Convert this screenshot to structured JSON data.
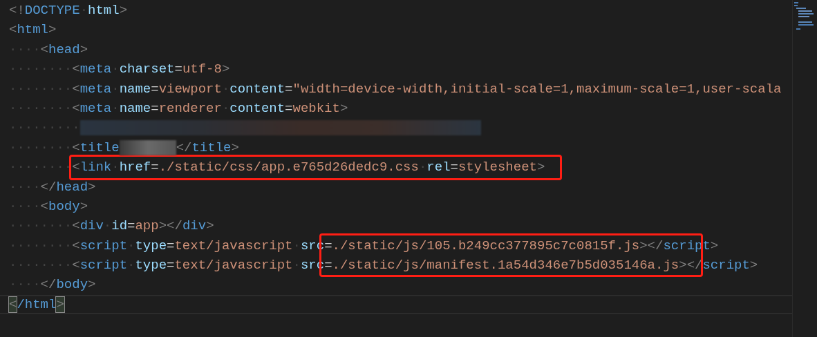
{
  "editor": {
    "lines": [
      {
        "current": false,
        "tokens": [
          {
            "kind": "punct",
            "text": "<!"
          },
          {
            "kind": "tag",
            "text": "DOCTYPE"
          },
          {
            "kind": "ws",
            "text": "·"
          },
          {
            "kind": "attr",
            "text": "html"
          },
          {
            "kind": "punct",
            "text": ">"
          }
        ]
      },
      {
        "current": false,
        "tokens": [
          {
            "kind": "punct",
            "text": "<"
          },
          {
            "kind": "tag",
            "text": "html"
          },
          {
            "kind": "punct",
            "text": ">"
          }
        ]
      },
      {
        "current": false,
        "tokens": [
          {
            "kind": "ws",
            "text": "····"
          },
          {
            "kind": "punct",
            "text": "<"
          },
          {
            "kind": "tag",
            "text": "head"
          },
          {
            "kind": "punct",
            "text": ">"
          }
        ]
      },
      {
        "current": false,
        "tokens": [
          {
            "kind": "ws",
            "text": "········"
          },
          {
            "kind": "punct",
            "text": "<"
          },
          {
            "kind": "tag",
            "text": "meta"
          },
          {
            "kind": "ws",
            "text": "·"
          },
          {
            "kind": "attr",
            "text": "charset"
          },
          {
            "kind": "eq",
            "text": "="
          },
          {
            "kind": "value",
            "text": "utf-8"
          },
          {
            "kind": "punct",
            "text": ">"
          }
        ]
      },
      {
        "current": false,
        "tokens": [
          {
            "kind": "ws",
            "text": "········"
          },
          {
            "kind": "punct",
            "text": "<"
          },
          {
            "kind": "tag",
            "text": "meta"
          },
          {
            "kind": "ws",
            "text": "·"
          },
          {
            "kind": "attr",
            "text": "name"
          },
          {
            "kind": "eq",
            "text": "="
          },
          {
            "kind": "value",
            "text": "viewport"
          },
          {
            "kind": "ws",
            "text": "·"
          },
          {
            "kind": "attr",
            "text": "content"
          },
          {
            "kind": "eq",
            "text": "="
          },
          {
            "kind": "value",
            "text": "\"width=device-width,initial-scale=1,maximum-scale=1,user-scala"
          }
        ]
      },
      {
        "current": false,
        "tokens": [
          {
            "kind": "ws",
            "text": "········"
          },
          {
            "kind": "punct",
            "text": "<"
          },
          {
            "kind": "tag",
            "text": "meta"
          },
          {
            "kind": "ws",
            "text": "·"
          },
          {
            "kind": "attr",
            "text": "name"
          },
          {
            "kind": "eq",
            "text": "="
          },
          {
            "kind": "value",
            "text": "renderer"
          },
          {
            "kind": "ws",
            "text": "·"
          },
          {
            "kind": "attr",
            "text": "content"
          },
          {
            "kind": "eq",
            "text": "="
          },
          {
            "kind": "value",
            "text": "webkit"
          },
          {
            "kind": "punct",
            "text": ">"
          }
        ]
      },
      {
        "current": false,
        "tokens": [
          {
            "kind": "ws",
            "text": "·········"
          },
          {
            "kind": "blur"
          }
        ]
      },
      {
        "current": false,
        "tokens": [
          {
            "kind": "ws",
            "text": "········"
          },
          {
            "kind": "punct",
            "text": "<"
          },
          {
            "kind": "tag",
            "text": "title"
          },
          {
            "kind": "blur-short"
          },
          {
            "kind": "punct",
            "text": "</"
          },
          {
            "kind": "tag",
            "text": "title"
          },
          {
            "kind": "punct",
            "text": ">"
          }
        ]
      },
      {
        "current": false,
        "tokens": [
          {
            "kind": "ws",
            "text": "········"
          },
          {
            "kind": "box",
            "tokens": [
              {
                "kind": "punct",
                "text": "<"
              },
              {
                "kind": "tag",
                "text": "link"
              },
              {
                "kind": "ws",
                "text": "·"
              },
              {
                "kind": "attr",
                "text": "href"
              },
              {
                "kind": "eq",
                "text": "="
              },
              {
                "kind": "value",
                "text": "./static/css/app.e765d26dedc9.css"
              },
              {
                "kind": "ws",
                "text": "·"
              },
              {
                "kind": "attr",
                "text": "rel"
              },
              {
                "kind": "eq",
                "text": "="
              },
              {
                "kind": "value",
                "text": "stylesheet"
              },
              {
                "kind": "punct",
                "text": ">"
              }
            ]
          }
        ]
      },
      {
        "current": false,
        "tokens": [
          {
            "kind": "ws",
            "text": "····"
          },
          {
            "kind": "punct",
            "text": "</"
          },
          {
            "kind": "tag",
            "text": "head"
          },
          {
            "kind": "punct",
            "text": ">"
          }
        ]
      },
      {
        "current": false,
        "tokens": [
          {
            "kind": "ws",
            "text": "····"
          },
          {
            "kind": "punct",
            "text": "<"
          },
          {
            "kind": "tag",
            "text": "body"
          },
          {
            "kind": "punct",
            "text": ">"
          }
        ]
      },
      {
        "current": false,
        "tokens": [
          {
            "kind": "ws",
            "text": "········"
          },
          {
            "kind": "punct",
            "text": "<"
          },
          {
            "kind": "tag",
            "text": "div"
          },
          {
            "kind": "ws",
            "text": "·"
          },
          {
            "kind": "attr",
            "text": "id"
          },
          {
            "kind": "eq",
            "text": "="
          },
          {
            "kind": "value",
            "text": "app"
          },
          {
            "kind": "punct",
            "text": "></"
          },
          {
            "kind": "tag",
            "text": "div"
          },
          {
            "kind": "punct",
            "text": ">"
          }
        ]
      },
      {
        "current": false,
        "tokens": [
          {
            "kind": "ws",
            "text": "········"
          },
          {
            "kind": "punct",
            "text": "<"
          },
          {
            "kind": "tag",
            "text": "script"
          },
          {
            "kind": "ws",
            "text": "·"
          },
          {
            "kind": "attr",
            "text": "type"
          },
          {
            "kind": "eq",
            "text": "="
          },
          {
            "kind": "value",
            "text": "text/javascript"
          },
          {
            "kind": "ws",
            "text": "·"
          },
          {
            "kind": "attr",
            "text": "src"
          },
          {
            "kind": "box",
            "tokens": [
              {
                "kind": "eq",
                "text": "="
              },
              {
                "kind": "value",
                "text": "./static/js/105.b249cc377895c7c0815f.js"
              }
            ]
          },
          {
            "kind": "punct",
            "text": "></"
          },
          {
            "kind": "tag",
            "text": "script"
          },
          {
            "kind": "punct",
            "text": ">"
          }
        ]
      },
      {
        "current": false,
        "tokens": [
          {
            "kind": "ws",
            "text": "········"
          },
          {
            "kind": "punct",
            "text": "<"
          },
          {
            "kind": "tag",
            "text": "script"
          },
          {
            "kind": "ws",
            "text": "·"
          },
          {
            "kind": "attr",
            "text": "type"
          },
          {
            "kind": "eq",
            "text": "="
          },
          {
            "kind": "value",
            "text": "text/javascript"
          },
          {
            "kind": "ws",
            "text": "·"
          },
          {
            "kind": "attr",
            "text": "src"
          },
          {
            "kind": "box",
            "tokens": [
              {
                "kind": "eq",
                "text": "="
              },
              {
                "kind": "value",
                "text": "./static/js/manifest.1a54d346e7b5d035146a.js"
              },
              {
                "kind": "punct",
                "text": ">"
              }
            ]
          },
          {
            "kind": "punct",
            "text": "</"
          },
          {
            "kind": "tag",
            "text": "script"
          },
          {
            "kind": "punct",
            "text": ">"
          }
        ]
      },
      {
        "current": false,
        "tokens": [
          {
            "kind": "ws",
            "text": "····"
          },
          {
            "kind": "punct",
            "text": "</"
          },
          {
            "kind": "tag",
            "text": "body"
          },
          {
            "kind": "punct",
            "text": ">"
          }
        ]
      },
      {
        "current": true,
        "tokens": [
          {
            "kind": "punct",
            "text": "<",
            "matched": true
          },
          {
            "kind": "tag",
            "text": "/html"
          },
          {
            "kind": "punct",
            "text": ">",
            "matched": true
          }
        ]
      }
    ]
  }
}
